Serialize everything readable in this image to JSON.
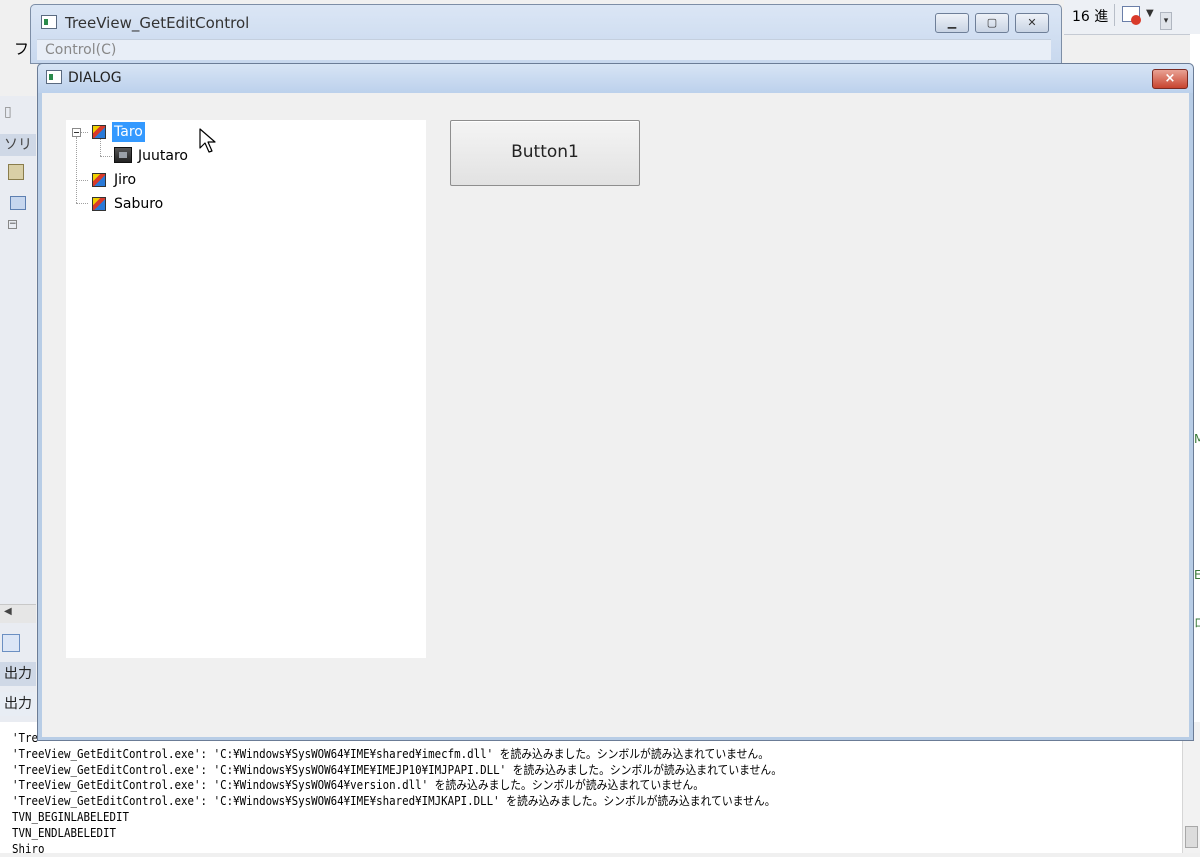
{
  "ide": {
    "left_menu_char": "フ",
    "left_header_1": "ソリ",
    "left_header_2": "出力",
    "left_header_3": "出力",
    "right_toolbar": {
      "hex_label": "16 進"
    },
    "right_marks": [
      "M",
      "E",
      "ロ"
    ]
  },
  "app_window": {
    "title": "TreeView_GetEditControl",
    "menu": [
      {
        "label": "Control(C)"
      }
    ]
  },
  "dialog": {
    "title": "DIALOG",
    "close_glyph": "×",
    "tree": {
      "nodes": [
        {
          "label": "Taro",
          "icon": "pencil-icon",
          "selected": true,
          "expanded": true
        },
        {
          "label": "Juutaro",
          "icon": "photo-icon",
          "child_of": "Taro"
        },
        {
          "label": "Jiro",
          "icon": "pencil-icon"
        },
        {
          "label": "Saburo",
          "icon": "pencil-icon"
        }
      ]
    },
    "button1_label": "Button1"
  },
  "output": {
    "lines": [
      "'Tre",
      "'TreeView_GetEditControl.exe': 'C:¥Windows¥SysWOW64¥IME¥shared¥imecfm.dll' を読み込みました。シンボルが読み込まれていません。",
      "'TreeView_GetEditControl.exe': 'C:¥Windows¥SysWOW64¥IME¥IMEJP10¥IMJPAPI.DLL' を読み込みました。シンボルが読み込まれていません。",
      "'TreeView_GetEditControl.exe': 'C:¥Windows¥SysWOW64¥version.dll' を読み込みました。シンボルが読み込まれていません。",
      "'TreeView_GetEditControl.exe': 'C:¥Windows¥SysWOW64¥IME¥shared¥IMJKAPI.DLL' を読み込みました。シンボルが読み込まれていません。",
      "TVN_BEGINLABELEDIT",
      "TVN_ENDLABELEDIT",
      "Shiro"
    ]
  }
}
